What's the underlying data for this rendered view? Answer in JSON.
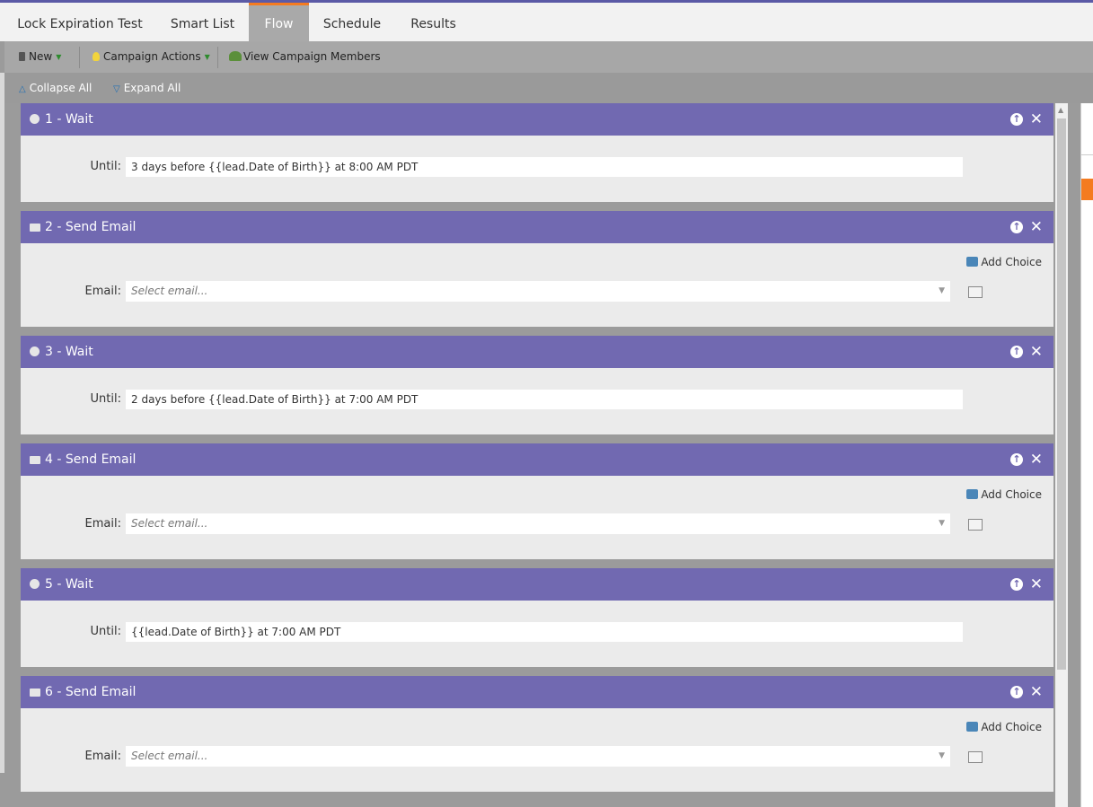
{
  "tabs": [
    {
      "label": "Lock Expiration Test"
    },
    {
      "label": "Smart List"
    },
    {
      "label": "Flow"
    },
    {
      "label": "Schedule"
    },
    {
      "label": "Results"
    }
  ],
  "toolbar": {
    "new_label": "New",
    "campaign_actions_label": "Campaign Actions",
    "view_members_label": "View Campaign Members"
  },
  "subbar": {
    "collapse_label": "Collapse All",
    "expand_label": "Expand All"
  },
  "labels": {
    "until": "Until:",
    "email": "Email:",
    "add_choice": "Add Choice",
    "select_placeholder": "Select email..."
  },
  "steps": [
    {
      "title": "1 - Wait",
      "value": "3 days before {{lead.Date of Birth}} at 8:00 AM PDT"
    },
    {
      "title": "2 - Send Email",
      "value": ""
    },
    {
      "title": "3 - Wait",
      "value": "2 days before {{lead.Date of Birth}} at 7:00 AM PDT"
    },
    {
      "title": "4 - Send Email",
      "value": ""
    },
    {
      "title": "5 - Wait",
      "value": "{{lead.Date of Birth}} at 7:00 AM PDT"
    },
    {
      "title": "6 - Send Email",
      "value": ""
    }
  ],
  "colors": {
    "step_header": "#7169b1",
    "active_tab_accent": "#f47b20",
    "top_border": "#5b5aa6"
  }
}
